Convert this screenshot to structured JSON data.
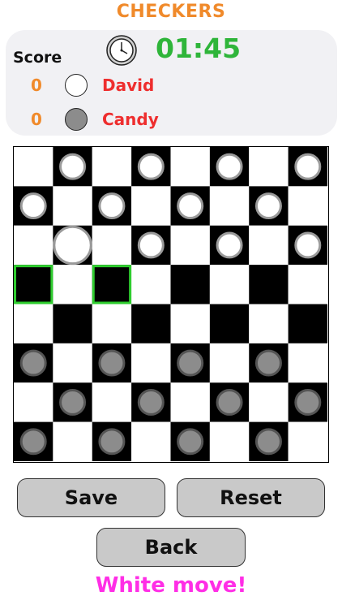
{
  "header": {
    "title": "CHECKERS"
  },
  "score_panel": {
    "score_label": "Score",
    "timer": "01:45",
    "players": [
      {
        "name": "David",
        "score": "0",
        "piece": "white"
      },
      {
        "name": "Candy",
        "score": "0",
        "piece": "gray"
      }
    ]
  },
  "board": {
    "size": 8,
    "colors": {
      "light_square": "#ffffff",
      "dark_square": "#000000",
      "white_piece": "#ffffff",
      "gray_piece": "#8c8c8c",
      "highlight": "#2ecc2e"
    },
    "pieces": [
      {
        "row": 0,
        "col": 1,
        "color": "white"
      },
      {
        "row": 0,
        "col": 3,
        "color": "white"
      },
      {
        "row": 0,
        "col": 5,
        "color": "white"
      },
      {
        "row": 0,
        "col": 7,
        "color": "white"
      },
      {
        "row": 1,
        "col": 0,
        "color": "white"
      },
      {
        "row": 1,
        "col": 2,
        "color": "white"
      },
      {
        "row": 1,
        "col": 4,
        "color": "white"
      },
      {
        "row": 1,
        "col": 6,
        "color": "white"
      },
      {
        "row": 2,
        "col": 1,
        "color": "white",
        "selected": true
      },
      {
        "row": 2,
        "col": 3,
        "color": "white"
      },
      {
        "row": 2,
        "col": 5,
        "color": "white"
      },
      {
        "row": 2,
        "col": 7,
        "color": "white"
      },
      {
        "row": 5,
        "col": 0,
        "color": "gray"
      },
      {
        "row": 5,
        "col": 2,
        "color": "gray"
      },
      {
        "row": 5,
        "col": 4,
        "color": "gray"
      },
      {
        "row": 5,
        "col": 6,
        "color": "gray"
      },
      {
        "row": 6,
        "col": 1,
        "color": "gray"
      },
      {
        "row": 6,
        "col": 3,
        "color": "gray"
      },
      {
        "row": 6,
        "col": 5,
        "color": "gray"
      },
      {
        "row": 6,
        "col": 7,
        "color": "gray"
      },
      {
        "row": 7,
        "col": 0,
        "color": "gray"
      },
      {
        "row": 7,
        "col": 2,
        "color": "gray"
      },
      {
        "row": 7,
        "col": 4,
        "color": "gray"
      },
      {
        "row": 7,
        "col": 6,
        "color": "gray"
      }
    ],
    "highlighted_squares": [
      {
        "row": 3,
        "col": 0
      },
      {
        "row": 3,
        "col": 2
      }
    ]
  },
  "buttons": {
    "save": "Save",
    "reset": "Reset",
    "back": "Back"
  },
  "status": "White move!"
}
